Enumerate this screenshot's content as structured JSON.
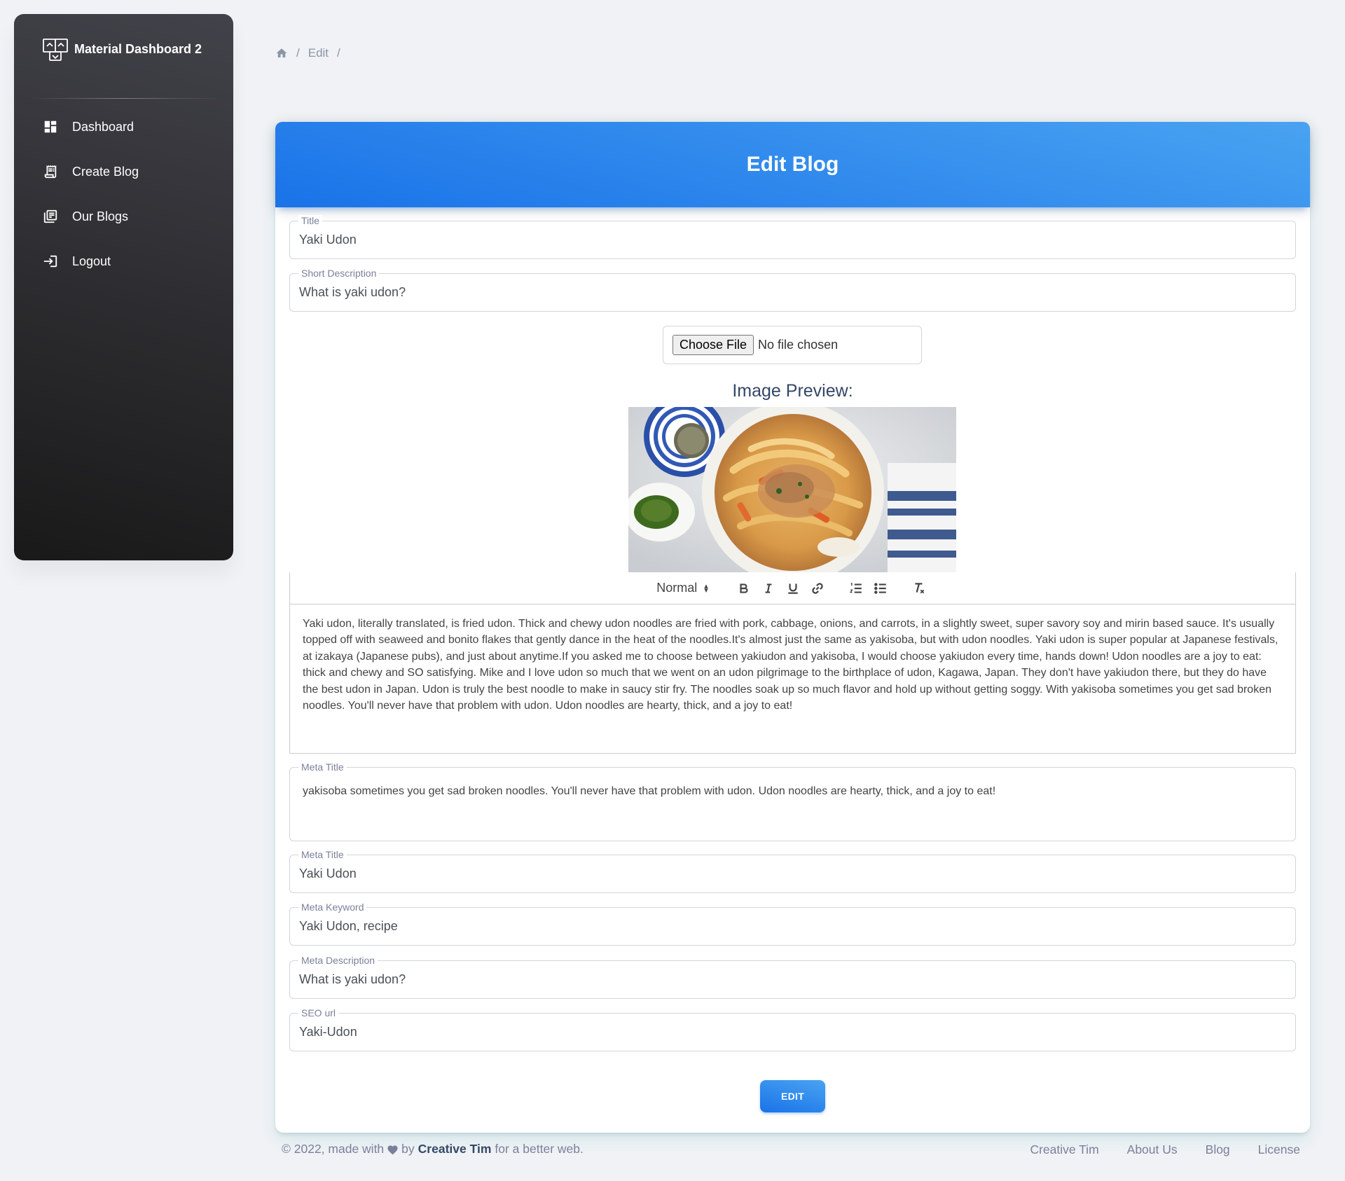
{
  "app": {
    "brand_name": "Material Dashboard 2"
  },
  "sidebar": {
    "items": [
      {
        "label": "Dashboard",
        "icon": "dashboard-icon"
      },
      {
        "label": "Create Blog",
        "icon": "receipt-icon"
      },
      {
        "label": "Our Blogs",
        "icon": "library-icon"
      },
      {
        "label": "Logout",
        "icon": "login-icon"
      }
    ]
  },
  "breadcrumb": {
    "home_icon": "home-icon",
    "current": "Edit",
    "separator": "/"
  },
  "form": {
    "header_title": "Edit Blog",
    "title": {
      "label": "Title",
      "value": "Yaki Udon"
    },
    "short_description": {
      "label": "Short Description",
      "value": "What is yaki udon?"
    },
    "file": {
      "button_label": "Choose File",
      "status": "No file chosen"
    },
    "preview_label": "Image Preview:",
    "editor": {
      "format_select": "Normal",
      "content": "Yaki udon, literally translated, is fried udon. Thick and chewy udon noodles are fried with pork, cabbage, onions, and carrots, in a slightly sweet, super savory soy and mirin based sauce. It's usually topped off with seaweed and bonito flakes that gently dance in the heat of the noodles.It's almost just the same as yakisoba, but with udon noodles. Yaki udon is super popular at Japanese festivals, at izakaya (Japanese pubs), and just about anytime.If you asked me to choose between yakiudon and yakisoba, I would choose yakiudon every time, hands down! Udon noodles are a joy to eat: thick and chewy and SO satisfying. Mike and I love udon so much that we went on an udon pilgrimage to the birthplace of udon, Kagawa, Japan. They don't have yakiudon there, but they do have the best udon in Japan. Udon is truly the best noodle to make in saucy stir fry. The noodles soak up so much flavor and hold up without getting soggy. With yakisoba sometimes you get sad broken noodles. You'll never have that problem with udon. Udon noodles are hearty, thick, and a joy to eat!"
    },
    "meta_area": {
      "label": "Meta Title",
      "value": "yakisoba sometimes you get sad broken noodles. You'll never have that problem with udon. Udon noodles are hearty, thick, and a joy to eat!"
    },
    "meta_title": {
      "label": "Meta Title",
      "value": "Yaki Udon"
    },
    "meta_keyword": {
      "label": "Meta Keyword",
      "value": "Yaki Udon, recipe"
    },
    "meta_description": {
      "label": "Meta Description",
      "value": "What is yaki udon?"
    },
    "seo_url": {
      "label": "SEO url",
      "value": "Yaki-Udon"
    },
    "submit_label": "EDIT"
  },
  "footer": {
    "copyright_prefix": "© 2022, made with",
    "by": "by",
    "author": "Creative Tim",
    "suffix": "for a better web.",
    "links": [
      "Creative Tim",
      "About Us",
      "Blog",
      "License"
    ]
  },
  "colors": {
    "accent": "#1a73e8",
    "accent_light": "#49a3f1",
    "sidebar_dark": "#191919",
    "page_bg": "#f0f2f5"
  }
}
